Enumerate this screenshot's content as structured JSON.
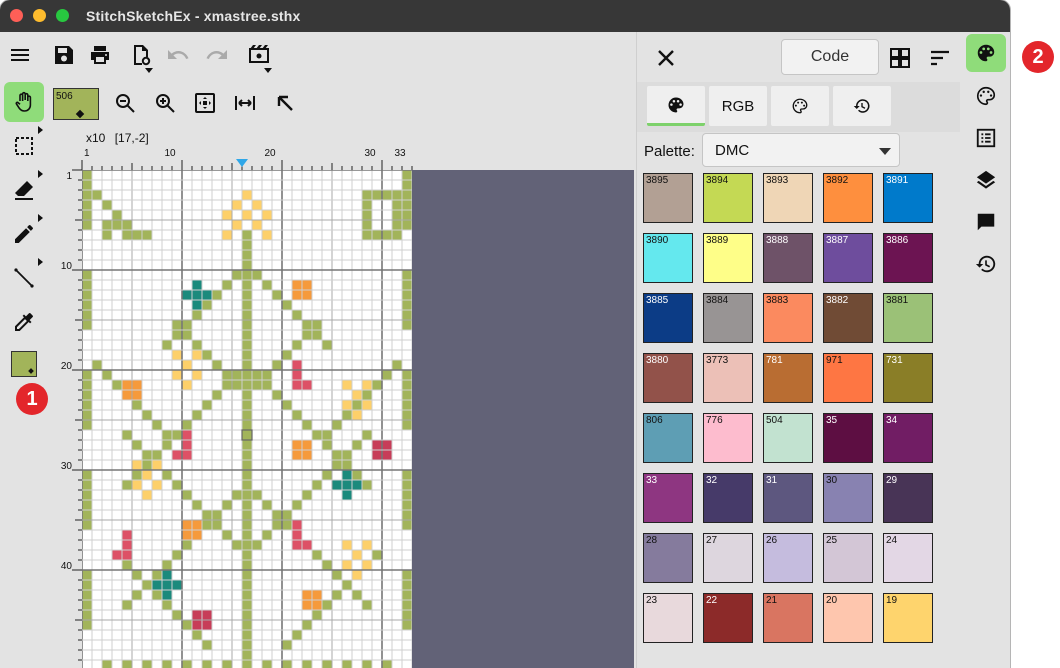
{
  "window": {
    "title": "StitchSketchEx - xmastree.sthx"
  },
  "toolbar": {
    "icons": [
      "menu-icon",
      "save-icon",
      "print-icon",
      "document-settings-icon",
      "undo-icon",
      "redo-icon",
      "video-settings-icon"
    ]
  },
  "subbar": {
    "selected_color": "506",
    "selected_color_hex": "#a2b45a",
    "icons": [
      "zoom-out-icon",
      "zoom-in-icon",
      "zoom-fit-icon",
      "fit-width-icon",
      "pointer-arrow-icon"
    ]
  },
  "canvas": {
    "zoom_label": "x10",
    "coords": "[17,-2]",
    "top_ruler": [
      "1",
      "10",
      "20",
      "30",
      "33"
    ],
    "left_ruler": [
      "1",
      "10",
      "20",
      "30",
      "40"
    ]
  },
  "panel": {
    "code_label": "Code",
    "tabs": [
      {
        "label": ""
      },
      {
        "label": "RGB"
      },
      {
        "label": ""
      },
      {
        "label": ""
      }
    ],
    "palette_label": "Palette:",
    "palette_value": "DMC",
    "colors": [
      {
        "code": "3895",
        "hex": "#b2a094",
        "text": "#111"
      },
      {
        "code": "3894",
        "hex": "#c4d954",
        "text": "#111"
      },
      {
        "code": "3893",
        "hex": "#efd6b6",
        "text": "#111"
      },
      {
        "code": "3892",
        "hex": "#fe8f3e",
        "text": "#111"
      },
      {
        "code": "3891",
        "hex": "#007acb",
        "text": "#fff"
      },
      {
        "code": "3890",
        "hex": "#64e8ee",
        "text": "#111"
      },
      {
        "code": "3889",
        "hex": "#fefe88",
        "text": "#111"
      },
      {
        "code": "3888",
        "hex": "#6e5268",
        "text": "#fff"
      },
      {
        "code": "3887",
        "hex": "#6e4d9d",
        "text": "#fff"
      },
      {
        "code": "3886",
        "hex": "#6c1452",
        "text": "#fff"
      },
      {
        "code": "3885",
        "hex": "#0c3c86",
        "text": "#fff"
      },
      {
        "code": "3884",
        "hex": "#989494",
        "text": "#111"
      },
      {
        "code": "3883",
        "hex": "#fb8a5f",
        "text": "#111"
      },
      {
        "code": "3882",
        "hex": "#704b35",
        "text": "#fff"
      },
      {
        "code": "3881",
        "hex": "#9bc177",
        "text": "#111"
      },
      {
        "code": "3880",
        "hex": "#92524a",
        "text": "#fff"
      },
      {
        "code": "3773",
        "hex": "#ecc0b7",
        "text": "#111"
      },
      {
        "code": "781",
        "hex": "#b96d32",
        "text": "#fff"
      },
      {
        "code": "971",
        "hex": "#fe7643",
        "text": "#111"
      },
      {
        "code": "731",
        "hex": "#8a7e27",
        "text": "#fff"
      },
      {
        "code": "806",
        "hex": "#5e9eb4",
        "text": "#111"
      },
      {
        "code": "776",
        "hex": "#fdbcce",
        "text": "#111"
      },
      {
        "code": "504",
        "hex": "#c2e2d0",
        "text": "#111"
      },
      {
        "code": "35",
        "hex": "#5d0e42",
        "text": "#fff"
      },
      {
        "code": "34",
        "hex": "#711d64",
        "text": "#fff"
      },
      {
        "code": "33",
        "hex": "#8e3681",
        "text": "#fff"
      },
      {
        "code": "32",
        "hex": "#463a69",
        "text": "#fff"
      },
      {
        "code": "31",
        "hex": "#5d577f",
        "text": "#fff"
      },
      {
        "code": "30",
        "hex": "#8882b1",
        "text": "#111"
      },
      {
        "code": "29",
        "hex": "#483456",
        "text": "#fff"
      },
      {
        "code": "28",
        "hex": "#857b9d",
        "text": "#111"
      },
      {
        "code": "27",
        "hex": "#ddd6de",
        "text": "#111"
      },
      {
        "code": "26",
        "hex": "#c5bcde",
        "text": "#111"
      },
      {
        "code": "25",
        "hex": "#d3c6d6",
        "text": "#111"
      },
      {
        "code": "24",
        "hex": "#e3d7e5",
        "text": "#111"
      },
      {
        "code": "23",
        "hex": "#e8d9dc",
        "text": "#111"
      },
      {
        "code": "22",
        "hex": "#8c2a29",
        "text": "#fff"
      },
      {
        "code": "21",
        "hex": "#d97561",
        "text": "#111"
      },
      {
        "code": "20",
        "hex": "#fec6ae",
        "text": "#111"
      },
      {
        "code": "19",
        "hex": "#fed46d",
        "text": "#111"
      }
    ]
  },
  "rightbar": {
    "icons": [
      "palette-icon",
      "palette-outline-icon",
      "list-icon",
      "layers-icon",
      "comment-icon",
      "history-icon"
    ]
  },
  "badges": {
    "one": "1",
    "two": "2"
  },
  "stitch_colors": {
    "green": "#a2b45a",
    "yellow": "#fdd06a",
    "orange": "#f59a3c",
    "teal": "#1b8a7c",
    "red": "#dd5166",
    "darkred": "#c73d58"
  }
}
